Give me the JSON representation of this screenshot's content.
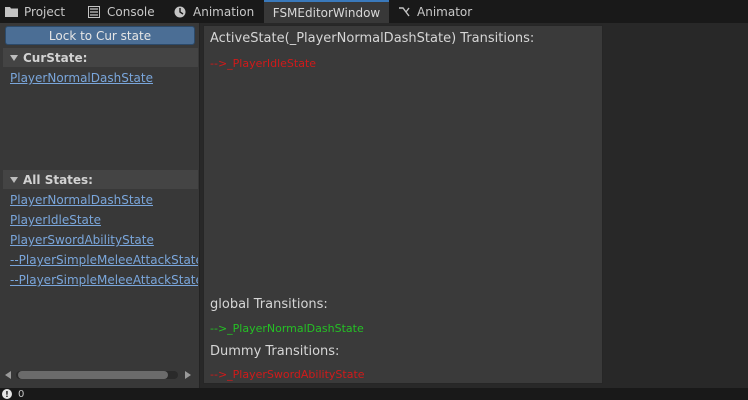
{
  "tabs": [
    {
      "label": "Project",
      "icon": "folder-icon"
    },
    {
      "label": "Console",
      "icon": "console-icon"
    },
    {
      "label": "Animation",
      "icon": "animation-icon"
    },
    {
      "label": "FSMEditorWindow",
      "icon": ""
    },
    {
      "label": "Animator",
      "icon": "animator-icon"
    }
  ],
  "active_tab": "FSMEditorWindow",
  "left": {
    "lock_button": "Lock to Cur state",
    "cur_state_header": "CurState:",
    "cur_state": "PlayerNormalDashState",
    "all_states_header": "All States:",
    "all_states": [
      "PlayerNormalDashState",
      "PlayerIdleState",
      "PlayerSwordAbilityState",
      "--PlayerSimpleMeleeAttackState",
      "--PlayerSimpleMeleeAttackState"
    ]
  },
  "right": {
    "active_title": "ActiveState(_PlayerNormalDashState) Transitions:",
    "active_transitions": [
      "-->_PlayerIdleState"
    ],
    "global_title": "global Transitions:",
    "global_transitions": [
      "-->_PlayerNormalDashState"
    ],
    "dummy_title": "Dummy Transitions:",
    "dummy_transitions": [
      "-->_PlayerSwordAbilityState"
    ]
  },
  "status": {
    "count": "0"
  },
  "colors": {
    "accent": "#3a79bb",
    "link": "#7aa6db",
    "transition_red": "#d11a1a",
    "transition_green": "#25c025"
  }
}
